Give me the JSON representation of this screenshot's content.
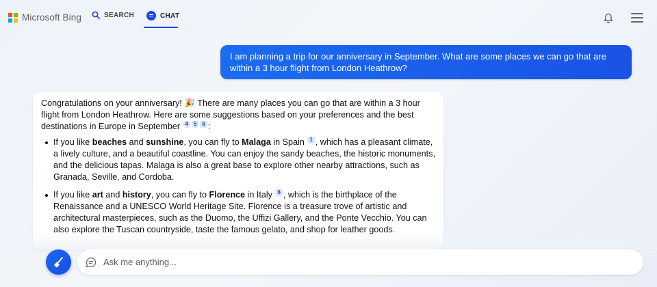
{
  "header": {
    "logo_text": "Microsoft Bing",
    "logo_colors": [
      "#f25022",
      "#7fba00",
      "#00a4ef",
      "#ffb900"
    ],
    "tabs": [
      {
        "label": "SEARCH",
        "icon": "search-icon",
        "active": false
      },
      {
        "label": "CHAT",
        "icon": "chat-bubble-icon",
        "active": true
      }
    ],
    "accent_color": "#174ae4"
  },
  "user_message": {
    "text": "I am planning a trip for our anniversary in September. What are some places we can go that are within a 3 hour flight from London Heathrow?"
  },
  "bot_message": {
    "intro": {
      "before_emoji": "Congratulations on your anniversary!",
      "emoji": "🎉",
      "after_emoji": "There are many places you can go that are within a 3 hour flight from London Heathrow. Here are some suggestions based on your preferences and the best destinations in Europe in September",
      "citations": [
        "4",
        "5",
        "6"
      ],
      "end": ":"
    },
    "items": [
      {
        "p1": "If you like ",
        "b1": "beaches",
        "p2": " and ",
        "b2": "sunshine",
        "p3": ", you can fly to ",
        "b3": "Malaga",
        "p4": " in Spain",
        "cite": "1",
        "p5": ", which has a pleasant climate, a lively culture, and a beautiful coastline. You can enjoy the sandy beaches, the historic monuments, and the delicious tapas. Malaga is also a great base to explore other nearby attractions, such as Granada, Seville, and Cordoba."
      },
      {
        "p1": "If you like ",
        "b1": "art",
        "p2": " and ",
        "b2": "history",
        "p3": ", you can fly to ",
        "b3": "Florence",
        "p4": " in Italy",
        "cite": "6",
        "p5": ", which is the birthplace of the Renaissance and a UNESCO World Heritage Site. Florence is a treasure trove of artistic and architectural masterpieces, such as the Duomo, the Uffizi Gallery, and the Ponte Vecchio. You can also explore the Tuscan countryside, taste the famous gelato, and shop for leather goods."
      }
    ]
  },
  "input": {
    "placeholder": "Ask me anything..."
  }
}
